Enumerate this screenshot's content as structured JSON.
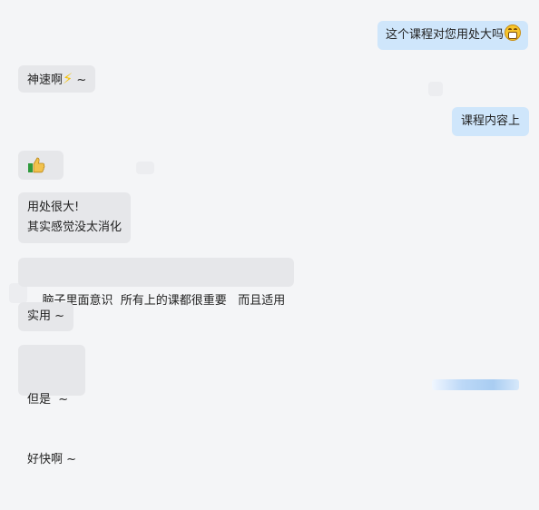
{
  "messages": {
    "m1": {
      "text": "这个课程对您用处大吗",
      "icon": "grinning-face-icon"
    },
    "m2": {
      "text": "神速啊",
      "tail": " ~",
      "icon": "lightning-icon"
    },
    "m3": {
      "text": "课程内容上"
    },
    "m4": {
      "icon": "thumbs-up-icon"
    },
    "m5": {
      "line1": "用处很大!",
      "line2": "其实感觉没太消化"
    },
    "m6": {
      "text": "脑子里面意识  所有上的课都很重要   而且适用"
    },
    "m7": {
      "text": "实用 ~"
    },
    "m8": {
      "line1": "但是  ~",
      "line2": "好快啊 ~"
    }
  },
  "colors": {
    "background": "#f4f5f7",
    "incoming_bubble": "#e6e7ea",
    "outgoing_bubble": "#cfe6fb"
  }
}
